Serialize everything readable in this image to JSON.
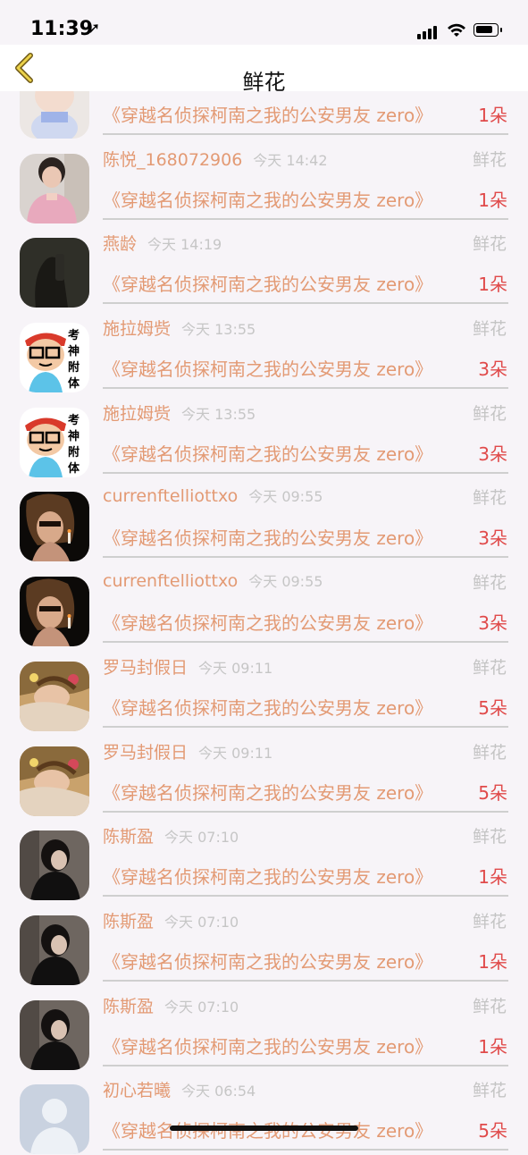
{
  "status_bar": {
    "time": "11:39",
    "location_icon": "location-arrow-icon",
    "signal_icon": "cellular-signal-icon",
    "wifi_icon": "wifi-icon",
    "battery_icon": "battery-icon"
  },
  "header": {
    "title": "鲜花",
    "back_icon": "chevron-left-icon"
  },
  "rows": [
    {
      "name": "",
      "time": "",
      "type": "",
      "book": "《穿越名侦探柯南之我的公安男友 zero》",
      "count": "1朵",
      "avatar": "doll-avatar"
    },
    {
      "name": "陈悦_168072906",
      "time": "今天 14:42",
      "type": "鲜花",
      "book": "《穿越名侦探柯南之我的公安男友 zero》",
      "count": "1朵",
      "avatar": "girl-pink-coat-avatar"
    },
    {
      "name": "燕龄",
      "time": "今天 14:19",
      "type": "鲜花",
      "book": "《穿越名侦探柯南之我的公安男友 zero》",
      "count": "1朵",
      "avatar": "dark-shadow-avatar"
    },
    {
      "name": "施拉姆赀",
      "time": "今天 13:55",
      "type": "鲜花",
      "book": "《穿越名侦探柯南之我的公安男友 zero》",
      "count": "3朵",
      "avatar": "cartoon-glasses-avatar"
    },
    {
      "name": "施拉姆赀",
      "time": "今天 13:55",
      "type": "鲜花",
      "book": "《穿越名侦探柯南之我的公安男友 zero》",
      "count": "3朵",
      "avatar": "cartoon-glasses-avatar"
    },
    {
      "name": "currenftelliottxo",
      "time": "今天 09:55",
      "type": "鲜花",
      "book": "《穿越名侦探柯南之我的公安男友 zero》",
      "count": "3朵",
      "avatar": "woman-smoking-avatar"
    },
    {
      "name": "currenftelliottxo",
      "time": "今天 09:55",
      "type": "鲜花",
      "book": "《穿越名侦探柯南之我的公安男友 zero》",
      "count": "3朵",
      "avatar": "woman-smoking-avatar"
    },
    {
      "name": "罗马封假日",
      "time": "今天 09:11",
      "type": "鲜花",
      "book": "《穿越名侦探柯南之我的公安男友 zero》",
      "count": "5朵",
      "avatar": "woman-flowers-avatar"
    },
    {
      "name": "罗马封假日",
      "time": "今天 09:11",
      "type": "鲜花",
      "book": "《穿越名侦探柯南之我的公安男友 zero》",
      "count": "5朵",
      "avatar": "woman-flowers-avatar"
    },
    {
      "name": "陈斯盈",
      "time": "今天 07:10",
      "type": "鲜花",
      "book": "《穿越名侦探柯南之我的公安男友 zero》",
      "count": "1朵",
      "avatar": "woman-dark-portrait-avatar"
    },
    {
      "name": "陈斯盈",
      "time": "今天 07:10",
      "type": "鲜花",
      "book": "《穿越名侦探柯南之我的公安男友 zero》",
      "count": "1朵",
      "avatar": "woman-dark-portrait-avatar"
    },
    {
      "name": "陈斯盈",
      "time": "今天 07:10",
      "type": "鲜花",
      "book": "《穿越名侦探柯南之我的公安男友 zero》",
      "count": "1朵",
      "avatar": "woman-dark-portrait-avatar"
    },
    {
      "name": "初心若曦",
      "time": "今天 06:54",
      "type": "鲜花",
      "book": "《穿越名侦探柯南之我的公安男友 zero》",
      "count": "5朵",
      "avatar": "default-user-avatar"
    }
  ],
  "colors": {
    "accent": "#e39a74",
    "count": "#e04a4a",
    "muted": "#c4c4c4",
    "back_icon": "#e6c018"
  }
}
